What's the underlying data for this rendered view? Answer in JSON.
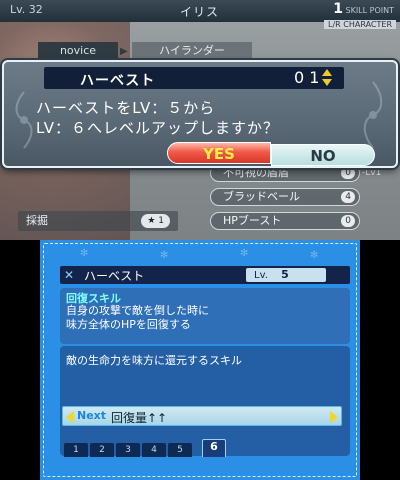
{
  "top_bar": {
    "level": "Lv. 32",
    "character_name": "イリス",
    "skill_point_value": "1",
    "skill_point_label": "SKILL POINT",
    "lr_label": "L/R CHARACTER"
  },
  "tabs": {
    "current": "novice",
    "next": "ハイランダー"
  },
  "background_skills": [
    {
      "label": "不可視の盾盾",
      "count": "0"
    },
    {
      "label": "ブラッドベール",
      "count": "4"
    },
    {
      "label": "HPブースト",
      "count": "0"
    }
  ],
  "background_misc": {
    "lv1_label": "-Lv1",
    "harvest_bg_label": "採掘",
    "harvest_bg_badge": "★ 1"
  },
  "dialog": {
    "title": "ハーベスト",
    "level_value": "0 1",
    "message_line1": "ハーベストをLV：５から",
    "message_line2": "LV：６へレベルアップしますか？",
    "yes_label": "YES",
    "no_label": "NO"
  },
  "skill_panel": {
    "name": "ハーベスト",
    "lv_label": "Lv.",
    "lv_value": "5",
    "type": "回復スキル",
    "desc_line1": "自身の攻撃で敵を倒した時に",
    "desc_line2": "味方全体のHPを回復する",
    "flavor": "敵の生命力を味方に還元するスキル",
    "next_label": "Next",
    "next_text": "回復量↑↑",
    "level_tabs": [
      "1",
      "2",
      "3",
      "4",
      "5",
      "6"
    ],
    "selected_tab": "6"
  },
  "icons": {
    "skill_type_icon": "x-icon",
    "dialog_arrows": "up-down-icon"
  },
  "colors": {
    "yes_red": "#e8463a",
    "no_teal": "#b8dede",
    "bottom_blue": "#2b8fe6",
    "accent_yellow": "#f0c92a"
  }
}
